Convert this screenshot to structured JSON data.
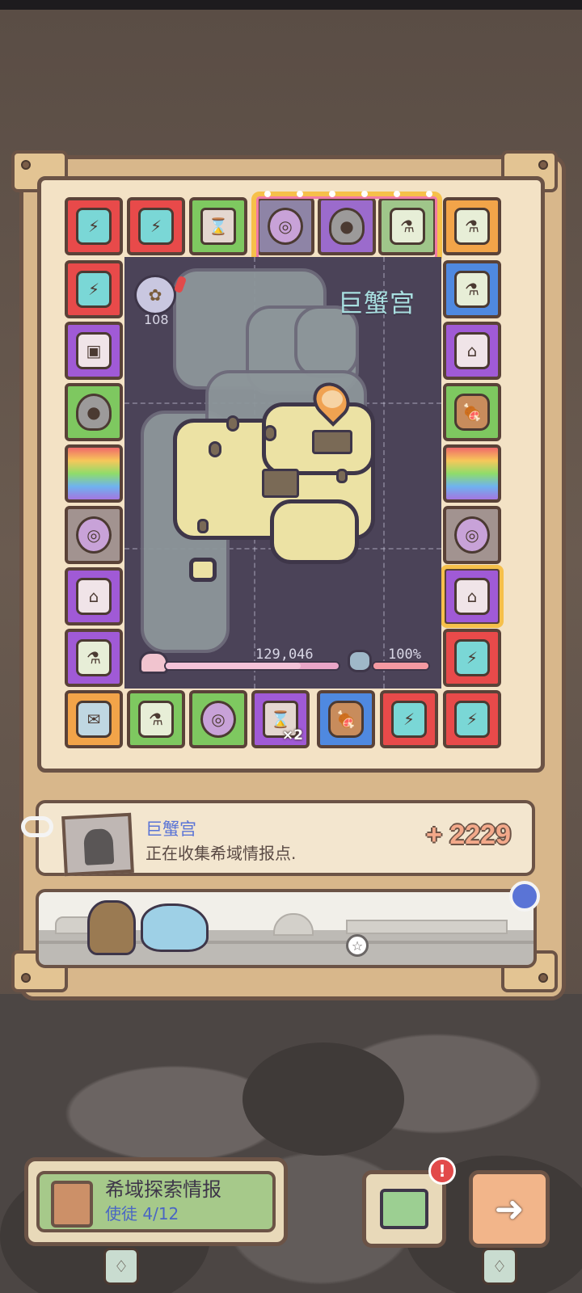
{
  "map": {
    "region_name": "巨蟹宫",
    "badge_count": "108",
    "progress_value": "129,046",
    "progress_fraction": 0.78,
    "hp_percent": "100%",
    "hp_fraction": 1.0
  },
  "board": {
    "top_row": [
      "battery",
      "battery",
      "hourglass",
      "magic-orb",
      "slime-blob",
      "potion",
      "potion"
    ],
    "left_column": [
      "battery",
      "treasure-box",
      "slime-blob",
      "card",
      "magic-orb",
      "house",
      "potion"
    ],
    "right_column": [
      "potion",
      "house",
      "meat",
      "card",
      "magic-orb",
      "house",
      "battery"
    ],
    "bottom_row": [
      "scroll",
      "potion",
      "magic-orb",
      "hourglass",
      "meat",
      "battery",
      "battery"
    ],
    "multiplier_label": "×2"
  },
  "info_card": {
    "title": "巨蟹宫",
    "subtitle": "正在收集希域情报点.",
    "score": "+ 2229"
  },
  "bottom": {
    "explore_title": "希域探索情报",
    "explore_sub": "使徒  4/12",
    "alert_mark": "!",
    "next_arrow": "➜"
  },
  "colors": {
    "frame": "#d8b78b",
    "border": "#6b5346",
    "accent_blue": "#5a74d6",
    "score_pink": "#f3a98a"
  }
}
